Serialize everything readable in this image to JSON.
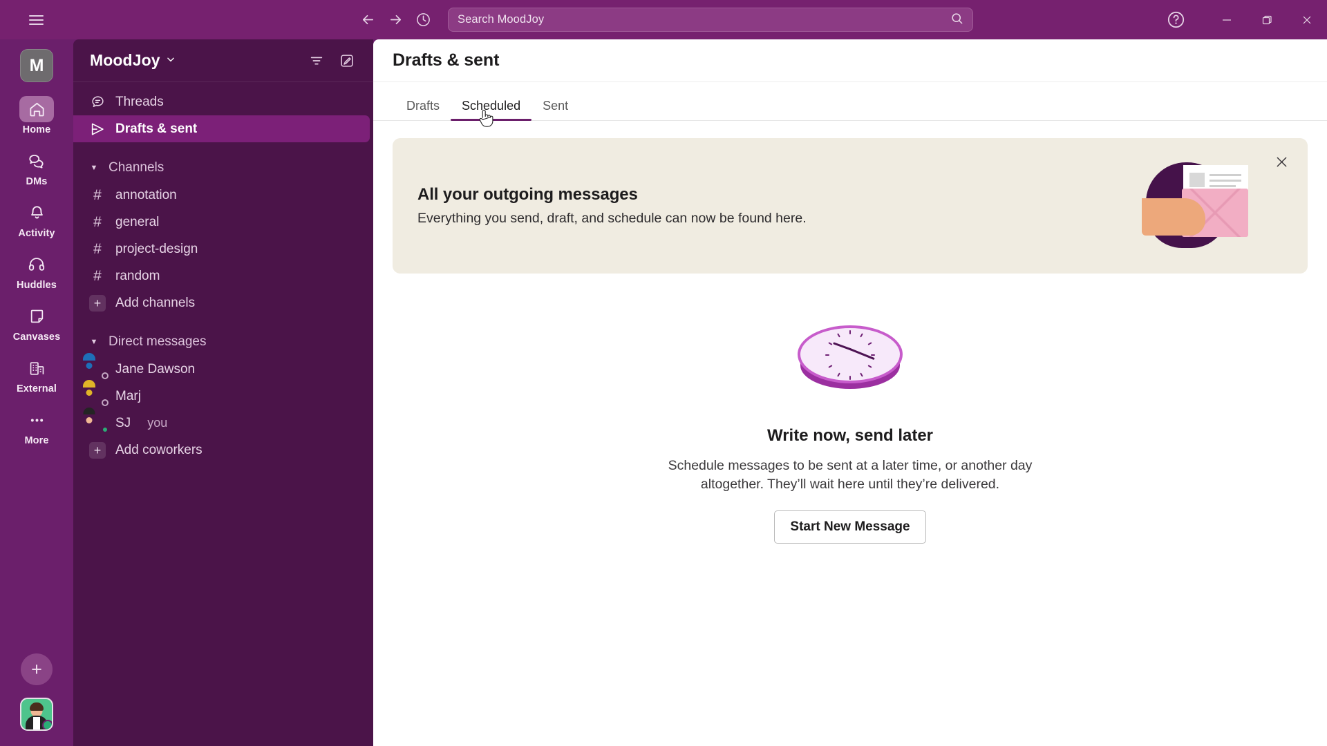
{
  "titlebar": {
    "hamburger_icon": "hamburger-menu-icon",
    "back_icon": "arrow-left-icon",
    "forward_icon": "arrow-right-icon",
    "history_icon": "clock-history-icon",
    "search_placeholder": "Search MoodJoy",
    "search_value": "Search MoodJoy",
    "search_icon": "search-icon",
    "help_icon": "help-circle-icon",
    "minimize_label": "–",
    "maximize_label": "❐",
    "close_label": "✕"
  },
  "rail": {
    "workspace_initial": "M",
    "items": [
      {
        "label": "Home",
        "icon": "home-icon",
        "active": true
      },
      {
        "label": "DMs",
        "icon": "dms-icon",
        "active": false
      },
      {
        "label": "Activity",
        "icon": "bell-icon",
        "active": false
      },
      {
        "label": "Huddles",
        "icon": "headphones-icon",
        "active": false
      },
      {
        "label": "Canvases",
        "icon": "canvas-icon",
        "active": false
      },
      {
        "label": "External",
        "icon": "building-icon",
        "active": false
      },
      {
        "label": "More",
        "icon": "ellipsis-icon",
        "active": false
      }
    ],
    "add_label": "+",
    "avatar_name": "user-avatar"
  },
  "sidebar": {
    "workspace_name": "MoodJoy",
    "chevron": "⌄",
    "filter_icon": "filter-icon",
    "compose_icon": "compose-icon",
    "nav": [
      {
        "label": "Threads",
        "icon": "threads-icon",
        "selected": false
      },
      {
        "label": "Drafts & sent",
        "icon": "paper-plane-icon",
        "selected": true
      }
    ],
    "channels_section": {
      "label": "Channels",
      "channels": [
        {
          "label": "annotation"
        },
        {
          "label": "general"
        },
        {
          "label": "project-design"
        },
        {
          "label": "random"
        }
      ],
      "add_label": "Add channels"
    },
    "dm_section": {
      "label": "Direct messages",
      "dms": [
        {
          "label": "Jane Dawson",
          "suffix": "",
          "avatar_color": "#1e6fb8",
          "avatar_bg": "#ffffff",
          "presence": "away"
        },
        {
          "label": "Marj",
          "suffix": "",
          "avatar_color": "#e0b428",
          "avatar_bg": "#ffffff",
          "presence": "away"
        },
        {
          "label": "SJ",
          "suffix": "you",
          "avatar_color": "#4ec48c",
          "avatar_bg": "#4ec48c",
          "presence": "online"
        }
      ],
      "add_label": "Add coworkers"
    }
  },
  "main": {
    "title": "Drafts & sent",
    "tabs": [
      {
        "label": "Drafts",
        "active": false
      },
      {
        "label": "Scheduled",
        "active": true
      },
      {
        "label": "Sent",
        "active": false
      }
    ],
    "banner": {
      "title": "All your outgoing messages",
      "subtitle": "Everything you send, draft, and schedule can now be found here.",
      "close_icon": "close-icon",
      "illustration": "hand-holding-envelope-illustration"
    },
    "empty_state": {
      "illustration": "isometric-clock-illustration",
      "title": "Write now, send later",
      "description": "Schedule messages to be sent at a later time, or another day altogether. They’ll wait here until they’re delivered.",
      "button_label": "Start New Message"
    }
  },
  "cursor": {
    "icon": "pointing-hand-cursor"
  },
  "colors": {
    "brand_purple": "#6b1f6b",
    "sidebar_purple": "#4b1449",
    "titlebar_purple": "#76216f",
    "selected_purple": "#7c2078",
    "banner_beige": "#f0ece1",
    "accent_pink": "#f2aec4"
  }
}
